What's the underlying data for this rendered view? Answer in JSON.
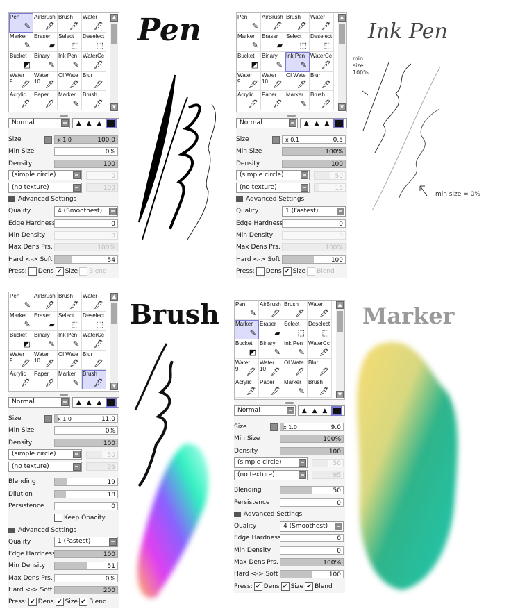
{
  "icons": {
    "pen": "✎",
    "brush": "🖌",
    "air": "✈",
    "drop": "💧"
  },
  "panels": [
    {
      "id": "pen",
      "selected": "Pen",
      "mode": "Normal",
      "rows": [
        {
          "type": "slider",
          "label": "Size",
          "value": "100.0",
          "fill": 1,
          "prefix": "x 1.0",
          "dd": true
        },
        {
          "type": "slider",
          "label": "Min Size",
          "value": "0%",
          "fill": 0
        },
        {
          "type": "slider",
          "label": "Density",
          "value": "100",
          "fill": 1
        },
        {
          "type": "select",
          "value": "(simple circle)",
          "num": "0",
          "fill": 0
        },
        {
          "type": "select",
          "value": "(no texture)",
          "num": "100",
          "fill": 1
        },
        {
          "type": "header",
          "label": "Advanced Settings"
        },
        {
          "type": "combo",
          "label": "Quality",
          "value": "4 (Smoothest)"
        },
        {
          "type": "slider",
          "label": "Edge Hardness",
          "value": "0",
          "fill": 0
        },
        {
          "type": "slider",
          "label": "Min Density",
          "value": "0",
          "fill": 0,
          "disabled": true
        },
        {
          "type": "slider",
          "label": "Max Dens Prs.",
          "value": "100%",
          "fill": 1,
          "disabled": true
        },
        {
          "type": "slider",
          "label": "Hard <-> Soft",
          "value": "54",
          "fill": 0.27
        },
        {
          "type": "press",
          "label": "Press:",
          "items": [
            {
              "label": "Dens",
              "checked": false
            },
            {
              "label": "Size",
              "checked": true
            },
            {
              "label": "Blend",
              "checked": false,
              "disabled": true
            }
          ]
        }
      ]
    },
    {
      "id": "inkpen",
      "selected": "Ink Pen",
      "mode": "Normal",
      "rows": [
        {
          "type": "slider",
          "label": "Size",
          "value": "0.5",
          "fill": 0,
          "prefix": "x 0.1",
          "dd": true
        },
        {
          "type": "slider",
          "label": "Min Size",
          "value": "100%",
          "fill": 1
        },
        {
          "type": "slider",
          "label": "Density",
          "value": "100",
          "fill": 1
        },
        {
          "type": "select",
          "value": "(simple circle)",
          "num": "50",
          "fill": 0.5
        },
        {
          "type": "select",
          "value": "(no texture)",
          "num": "16",
          "fill": 0.16
        },
        {
          "type": "header",
          "label": "Advanced Settings"
        },
        {
          "type": "combo",
          "label": "Quality",
          "value": "1 (Fastest)"
        },
        {
          "type": "slider",
          "label": "Edge Hardness",
          "value": "0",
          "fill": 0
        },
        {
          "type": "slider",
          "label": "Min Density",
          "value": "0",
          "fill": 0,
          "disabled": true
        },
        {
          "type": "slider",
          "label": "Max Dens Prs.",
          "value": "100%",
          "fill": 1,
          "disabled": true
        },
        {
          "type": "slider",
          "label": "Hard <-> Soft",
          "value": "100",
          "fill": 0.5
        },
        {
          "type": "press",
          "label": "Press:",
          "items": [
            {
              "label": "Dens",
              "checked": false
            },
            {
              "label": "Size",
              "checked": true
            },
            {
              "label": "Blend",
              "checked": false,
              "disabled": true
            }
          ]
        }
      ]
    },
    {
      "id": "brush",
      "selected": "Brush",
      "mode": "Normal",
      "rows": [
        {
          "type": "slider",
          "label": "Size",
          "value": "11.0",
          "fill": 0.06,
          "prefix": "x 1.0",
          "dd": true
        },
        {
          "type": "slider",
          "label": "Min Size",
          "value": "0%",
          "fill": 0
        },
        {
          "type": "slider",
          "label": "Density",
          "value": "100",
          "fill": 1
        },
        {
          "type": "select",
          "value": "(simple circle)",
          "num": "50",
          "fill": 0.5
        },
        {
          "type": "select",
          "value": "(no texture)",
          "num": "95",
          "fill": 0.95
        },
        {
          "type": "gap"
        },
        {
          "type": "slider",
          "label": "Blending",
          "value": "19",
          "fill": 0.19
        },
        {
          "type": "slider",
          "label": "Dilution",
          "value": "18",
          "fill": 0.18
        },
        {
          "type": "slider",
          "label": "Persistence",
          "value": "0",
          "fill": 0
        },
        {
          "type": "check",
          "label": "Keep Opacity",
          "checked": false
        },
        {
          "type": "header",
          "label": "Advanced Settings"
        },
        {
          "type": "combo",
          "label": "Quality",
          "value": "1 (Fastest)"
        },
        {
          "type": "slider",
          "label": "Edge Hardness",
          "value": "100",
          "fill": 1
        },
        {
          "type": "slider",
          "label": "Min Density",
          "value": "51",
          "fill": 0.51
        },
        {
          "type": "slider",
          "label": "Max Dens Prs.",
          "value": "0%",
          "fill": 0
        },
        {
          "type": "slider",
          "label": "Hard <-> Soft",
          "value": "200",
          "fill": 1
        },
        {
          "type": "press",
          "label": "Press:",
          "items": [
            {
              "label": "Dens",
              "checked": true
            },
            {
              "label": "Size",
              "checked": true
            },
            {
              "label": "Blend",
              "checked": true
            }
          ]
        }
      ]
    },
    {
      "id": "marker",
      "selected": "Marker",
      "mode": "Normal",
      "rows": [
        {
          "type": "slider",
          "label": "Size",
          "value": "9.0",
          "fill": 0.05,
          "prefix": "x 1.0",
          "dd": true
        },
        {
          "type": "slider",
          "label": "Min Size",
          "value": "100%",
          "fill": 1
        },
        {
          "type": "slider",
          "label": "Density",
          "value": "100",
          "fill": 1
        },
        {
          "type": "select",
          "value": "(simple circle)",
          "num": "50",
          "fill": 0.5
        },
        {
          "type": "select",
          "value": "(no texture)",
          "num": "95",
          "fill": 0.95
        },
        {
          "type": "gap"
        },
        {
          "type": "slider",
          "label": "Blending",
          "value": "50",
          "fill": 0.5
        },
        {
          "type": "slider",
          "label": "Persistence",
          "value": "0",
          "fill": 0
        },
        {
          "type": "header",
          "label": "Advanced Settings"
        },
        {
          "type": "combo",
          "label": "Quality",
          "value": "4 (Smoothest)"
        },
        {
          "type": "slider",
          "label": "Edge Hardness",
          "value": "0",
          "fill": 0
        },
        {
          "type": "slider",
          "label": "Min Density",
          "value": "0",
          "fill": 0
        },
        {
          "type": "slider",
          "label": "Max Dens Prs.",
          "value": "100%",
          "fill": 1
        },
        {
          "type": "slider",
          "label": "Hard <-> Soft",
          "value": "100",
          "fill": 0.5
        },
        {
          "type": "press",
          "label": "Press:",
          "items": [
            {
              "label": "Dens",
              "checked": true
            },
            {
              "label": "Size",
              "checked": true
            },
            {
              "label": "Blend",
              "checked": true
            }
          ]
        }
      ]
    }
  ],
  "tools": [
    "Pen",
    "AirBrush",
    "Brush",
    "Water",
    "Marker",
    "Eraser",
    "Select",
    "Deselect",
    "Bucket",
    "Binary",
    "Ink Pen",
    "WaterCc",
    "Water\n9",
    "Water\n10",
    "Ol Wate",
    "Blur",
    "Acrylic",
    "Paper",
    "Marker",
    "Brush"
  ],
  "titles": {
    "pen": "Pen",
    "inkpen": "Ink Pen",
    "brush": "Brush",
    "marker": "Marker"
  },
  "notes": {
    "min100": "min\nsize\n100%",
    "min0": "min size = 0%"
  }
}
